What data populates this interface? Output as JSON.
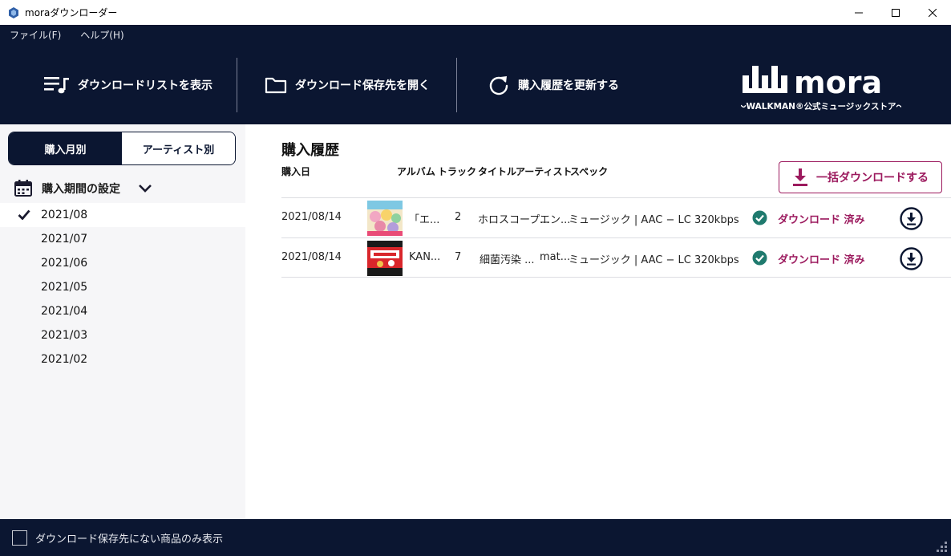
{
  "window": {
    "title": "moraダウンローダー"
  },
  "menu": {
    "file": "ファイル(F)",
    "help": "ヘルプ(H)"
  },
  "toolbar": {
    "show_list": "ダウンロードリストを表示",
    "open_folder": "ダウンロード保存先を開く",
    "refresh": "購入履歴を更新する"
  },
  "logo": {
    "name": "mora",
    "tagline": "〜WALKMAN®公式ミュージックストア〜"
  },
  "sidebar": {
    "tabs": [
      {
        "label": "購入月別",
        "active": true
      },
      {
        "label": "アーティスト別",
        "active": false
      }
    ],
    "period_label": "購入期間の設定",
    "months": [
      {
        "label": "2021/08",
        "selected": true
      },
      {
        "label": "2021/07",
        "selected": false
      },
      {
        "label": "2021/06",
        "selected": false
      },
      {
        "label": "2021/05",
        "selected": false
      },
      {
        "label": "2021/04",
        "selected": false
      },
      {
        "label": "2021/03",
        "selected": false
      },
      {
        "label": "2021/02",
        "selected": false
      }
    ]
  },
  "main": {
    "title": "購入履歴",
    "columns": {
      "date": "購入日",
      "album": "アルバム",
      "track": "トラック",
      "title": "タイトル",
      "artist": "アーティスト",
      "spec": "スペック"
    },
    "bulk_download": "一括ダウンロードする",
    "rows": [
      {
        "date": "2021/08/14",
        "album": "「エ...",
        "track": "2",
        "title": "ホロスコープ...",
        "artist": "エン...",
        "spec": "ミュージック | AAC − LC 320kbps",
        "status": "ダウンロード 済み"
      },
      {
        "date": "2021/08/14",
        "album": "KAN...",
        "track": "7",
        "title": "細菌汚染 ...",
        "artist": "mat...",
        "spec": "ミュージック | AAC − LC 320kbps",
        "status": "ダウンロード 済み"
      }
    ]
  },
  "footer": {
    "only_missing_label": "ダウンロード保存先にない商品のみ表示"
  },
  "colors": {
    "navy": "#0b1631",
    "accent": "#9c1a5e",
    "ok_green": "#1f7a6e"
  }
}
